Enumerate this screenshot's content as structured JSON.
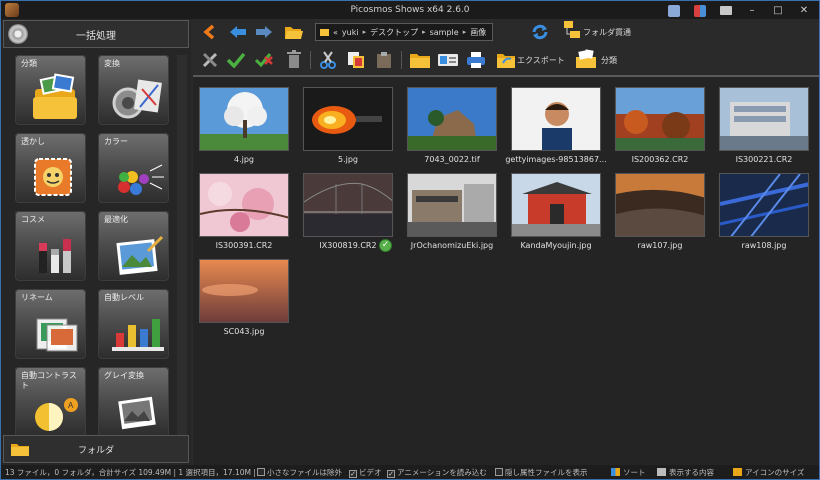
{
  "window": {
    "title": "Picosmos Shows x64 2.6.0"
  },
  "left_panel": {
    "batch_label": "一括処理",
    "tiles": [
      {
        "label": "分類",
        "icon": "folder-photos-icon"
      },
      {
        "label": "変換",
        "icon": "convert-icon"
      },
      {
        "label": "透かし",
        "icon": "watermark-icon"
      },
      {
        "label": "カラー",
        "icon": "color-balls-icon"
      },
      {
        "label": "コスメ",
        "icon": "cosmetics-icon"
      },
      {
        "label": "最適化",
        "icon": "optimize-picture-icon"
      },
      {
        "label": "リネーム",
        "icon": "rename-icon"
      },
      {
        "label": "自動レベル",
        "icon": "bar-chart-icon"
      },
      {
        "label": "自動コントラスト",
        "icon": "contrast-sun-icon"
      },
      {
        "label": "グレイ変換",
        "icon": "gray-photo-icon"
      }
    ],
    "folder_label": "フォルダ"
  },
  "navbar": {
    "address": {
      "prefix": "«",
      "parts": [
        "yuki",
        "デスクトップ",
        "sample",
        "画像"
      ]
    },
    "folder_through_label": "フォルダ貫通"
  },
  "toolbar": {
    "export_label": "エクスポート",
    "classify_label": "分類"
  },
  "thumbnails": [
    {
      "name": "4.jpg",
      "art": "tree"
    },
    {
      "name": "5.jpg",
      "art": "fire"
    },
    {
      "name": "7043_0022.tif",
      "art": "rock"
    },
    {
      "name": "gettyimages-98513867...",
      "art": "man"
    },
    {
      "name": "IS200362.CR2",
      "art": "autumn"
    },
    {
      "name": "IS300221.CR2",
      "art": "building"
    },
    {
      "name": "IS300391.CR2",
      "art": "blossom"
    },
    {
      "name": "IX300819.CR2",
      "art": "bridge-dusk",
      "checked": true
    },
    {
      "name": "JrOchanomizuEki.jpg",
      "art": "station"
    },
    {
      "name": "KandaMyoujin.jpg",
      "art": "shrine"
    },
    {
      "name": "raw107.jpg",
      "art": "sea"
    },
    {
      "name": "raw108.jpg",
      "art": "bridge-blue"
    },
    {
      "name": "SC043.jpg",
      "art": "sunset"
    }
  ],
  "status_bar": {
    "summary": "13 ファイル，0 フォルダ，合計サイズ 109.49M | 1 選択項目，17.10M |",
    "small_files_label": "小さなファイルは除外",
    "video_label": "ビデオ",
    "animation_label": "アニメーションを読み込む",
    "hidden_label": "隠し属性ファイルを表示",
    "sort_label": "ソート",
    "display_label": "表示する内容",
    "icon_size_label": "アイコンのサイズ"
  },
  "colors": {
    "accent_blue": "#3a8ee0",
    "nav_orange": "#f07a1a",
    "check_green": "#58b04b"
  }
}
